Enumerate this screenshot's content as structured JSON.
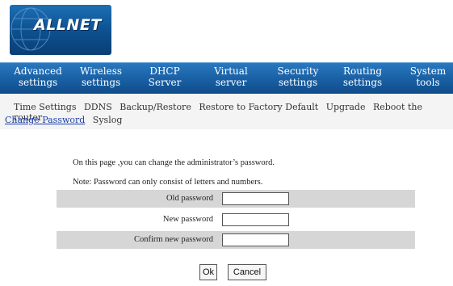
{
  "brand": {
    "logo_text": "ALLNET",
    "accent": "#1b63a8"
  },
  "nav": {
    "items": [
      {
        "line1": "Advanced",
        "line2": "settings"
      },
      {
        "line1": "Wireless",
        "line2": "settings"
      },
      {
        "line1": "DHCP",
        "line2": "Server"
      },
      {
        "line1": "Virtual",
        "line2": "server"
      },
      {
        "line1": "Security",
        "line2": "settings"
      },
      {
        "line1": "Routing",
        "line2": "settings"
      },
      {
        "line1": "System",
        "line2": "tools"
      }
    ]
  },
  "subnav": {
    "items": [
      {
        "label": "Time Settings"
      },
      {
        "label": "DDNS"
      },
      {
        "label": "Backup/Restore"
      },
      {
        "label": "Restore to Factory Default"
      },
      {
        "label": "Upgrade"
      },
      {
        "label": "Reboot the router"
      },
      {
        "label": "Change Password",
        "active": true
      },
      {
        "label": "Syslog"
      }
    ]
  },
  "content": {
    "intro": "On this page ,you can change the administrator’s password.",
    "note": "Note: Password can only consist of letters and numbers.",
    "old_password_label": "Old password",
    "new_password_label": "New password",
    "confirm_password_label": "Confirm new password",
    "old_password_value": "",
    "new_password_value": "",
    "confirm_password_value": ""
  },
  "buttons": {
    "ok_label": "Ok",
    "cancel_label": "Cancel"
  }
}
